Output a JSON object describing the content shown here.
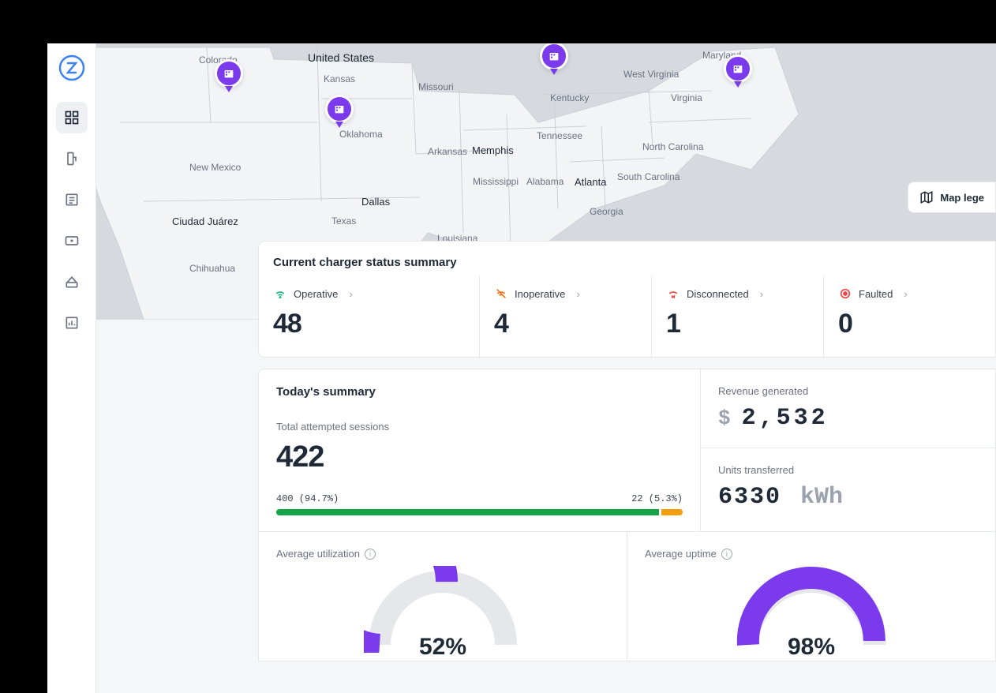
{
  "map": {
    "legend_label": "Map lege",
    "labels": {
      "united_states": "United States",
      "colorado": "Colorado",
      "kansas": "Kansas",
      "missouri": "Missouri",
      "new_mexico": "New Mexico",
      "oklahoma": "Oklahoma",
      "texas": "Texas",
      "chihuahua": "Chihuahua",
      "ciudad_juarez": "Ciudad Juárez",
      "arkansas": "Arkansas",
      "memphis": "Memphis",
      "mississippi": "Mississippi",
      "louisiana": "Louisiana",
      "dallas": "Dallas",
      "alabama": "Alabama",
      "tennessee": "Tennessee",
      "georgia": "Georgia",
      "kentucky": "Kentucky",
      "west_virginia": "West Virginia",
      "maryland": "Maryland",
      "virginia": "Virginia",
      "north_carolina": "North Carolina",
      "south_carolina": "South Carolina",
      "atlanta": "Atlanta"
    }
  },
  "charger_status": {
    "title": "Current charger status summary",
    "operative": {
      "label": "Operative",
      "count": "48"
    },
    "inoperative": {
      "label": "Inoperative",
      "count": "4"
    },
    "disconnected": {
      "label": "Disconnected",
      "count": "1"
    },
    "faulted": {
      "label": "Faulted",
      "count": "0"
    }
  },
  "today_summary": {
    "title": "Today's summary",
    "sessions_label": "Total attempted sessions",
    "sessions_count": "422",
    "success_text": "400 (94.7%)",
    "fail_text": "22 (5.3%)",
    "success_pct": 94.7,
    "fail_pct": 5.3
  },
  "revenue": {
    "label": "Revenue generated",
    "currency": "$",
    "amount": "2,532"
  },
  "units": {
    "label": "Units transferred",
    "value": "6330",
    "unit": "kWh"
  },
  "utilization": {
    "label": "Average utilization",
    "value": "52%",
    "pct": 52
  },
  "uptime": {
    "label": "Average uptime",
    "value": "98%",
    "pct": 98
  }
}
